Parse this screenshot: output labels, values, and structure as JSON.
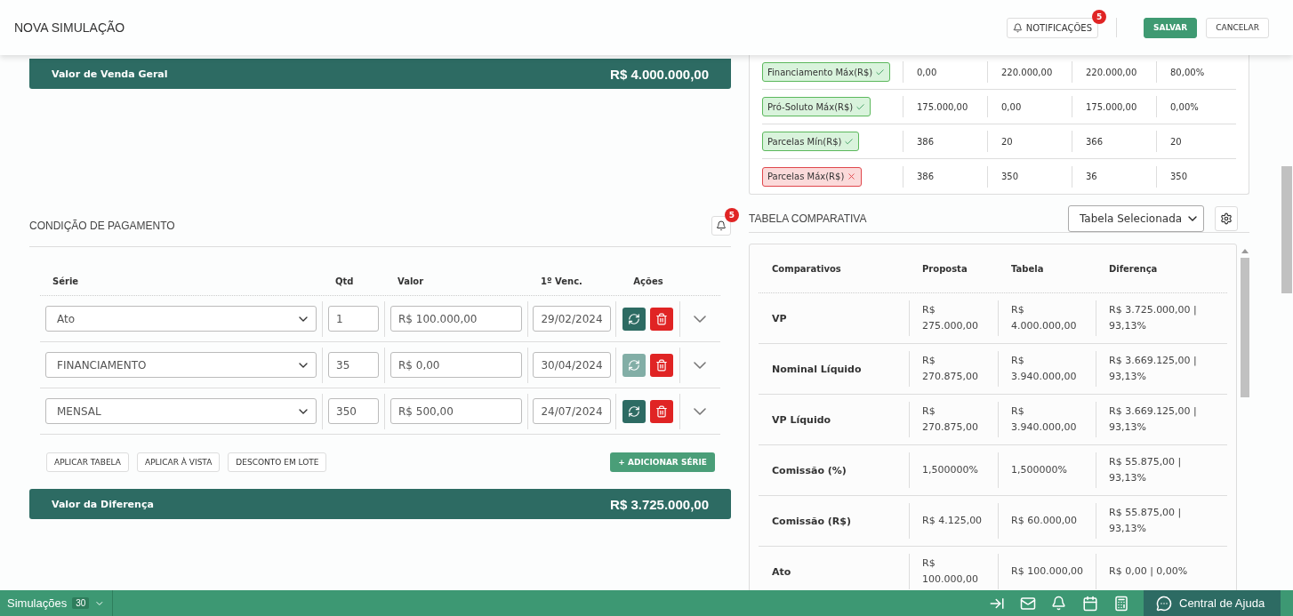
{
  "header": {
    "title": "NOVA SIMULAÇÃO",
    "notifications": {
      "label": "NOTIFICAÇÕES",
      "count": "5"
    },
    "buttons": [
      {
        "label": "SALVAR",
        "kind": "primary"
      },
      {
        "label": "CANCELAR",
        "kind": "secondary"
      }
    ]
  },
  "sale_total": {
    "label": "Valor de Venda Geral",
    "value": "R$ 4.000.000,00"
  },
  "limits": {
    "rows": [
      {
        "label": "Financiamento Máx(R$)",
        "passed": true,
        "values": [
          "0,00",
          "220.000,00",
          "220.000,00",
          "80,00%"
        ]
      },
      {
        "label": "Pró-Soluto Máx(R$)",
        "passed": true,
        "values": [
          "175.000,00",
          "0,00",
          "175.000,00",
          "0,00%"
        ]
      },
      {
        "label": "Parcelas Mín(R$)",
        "passed": true,
        "values": [
          "386",
          "20",
          "366",
          "20"
        ]
      },
      {
        "label": "Parcelas Máx(R$)",
        "passed": false,
        "values": [
          "386",
          "350",
          "36",
          "350"
        ]
      }
    ]
  },
  "payment": {
    "title": "CONDIÇÃO DE PAGAMENTO",
    "alert_count": "5",
    "columns": [
      "Série",
      "Qtd",
      "Valor",
      "1º Venc.",
      "Ações"
    ],
    "rows": [
      {
        "serie": "Ato",
        "qtd": "1",
        "valor": "R$ 100.000,00",
        "vencimento": "29/02/2024",
        "refresh_disabled": false
      },
      {
        "serie": "FINANCIAMENTO",
        "qtd": "35",
        "valor": "R$ 0,00",
        "vencimento": "30/04/2024",
        "refresh_disabled": true
      },
      {
        "serie": "MENSAL",
        "qtd": "350",
        "valor": "R$ 500,00",
        "vencimento": "24/07/2024",
        "refresh_disabled": false
      }
    ],
    "actions": [
      "APLICAR TABELA",
      "APLICAR À VISTA",
      "DESCONTO EM LOTE"
    ],
    "add_button": "+ ADICIONAR SÉRIE",
    "difference": {
      "label": "Valor da Diferença",
      "value": "R$ 3.725.000,00"
    }
  },
  "comparison": {
    "title": "TABELA COMPARATIVA",
    "select": "Tabela Selecionada",
    "columns": [
      "Comparativos",
      "Proposta",
      "Tabela",
      "Diferença"
    ],
    "rows": [
      {
        "label": "VP",
        "proposta": "R$ 275.000,00",
        "tabela": "R$ 4.000.000,00",
        "diferenca": "R$ 3.725.000,00 | 93,13%"
      },
      {
        "label": "Nominal Líquido",
        "proposta": "R$ 270.875,00",
        "tabela": "R$ 3.940.000,00",
        "diferenca": "R$ 3.669.125,00 | 93,13%"
      },
      {
        "label": "VP Líquido",
        "proposta": "R$ 270.875,00",
        "tabela": "R$ 3.940.000,00",
        "diferenca": "R$ 3.669.125,00 | 93,13%"
      },
      {
        "label": "Comissão (%)",
        "proposta": "1,500000%",
        "tabela": "1,500000%",
        "diferenca": "R$ 55.875,00 | 93,13%"
      },
      {
        "label": "Comissão (R$)",
        "proposta": "R$ 4.125,00",
        "tabela": "R$ 60.000,00",
        "diferenca": "R$ 55.875,00 | 93,13%"
      },
      {
        "label": "Ato",
        "proposta": "R$ 100.000,00",
        "tabela": "R$ 100.000,00",
        "diferenca": "R$ 0,00 | 0,00%"
      }
    ]
  },
  "footer": {
    "simulations": {
      "label": "Simulações",
      "count": "30"
    },
    "help": "Central de Ajuda"
  }
}
